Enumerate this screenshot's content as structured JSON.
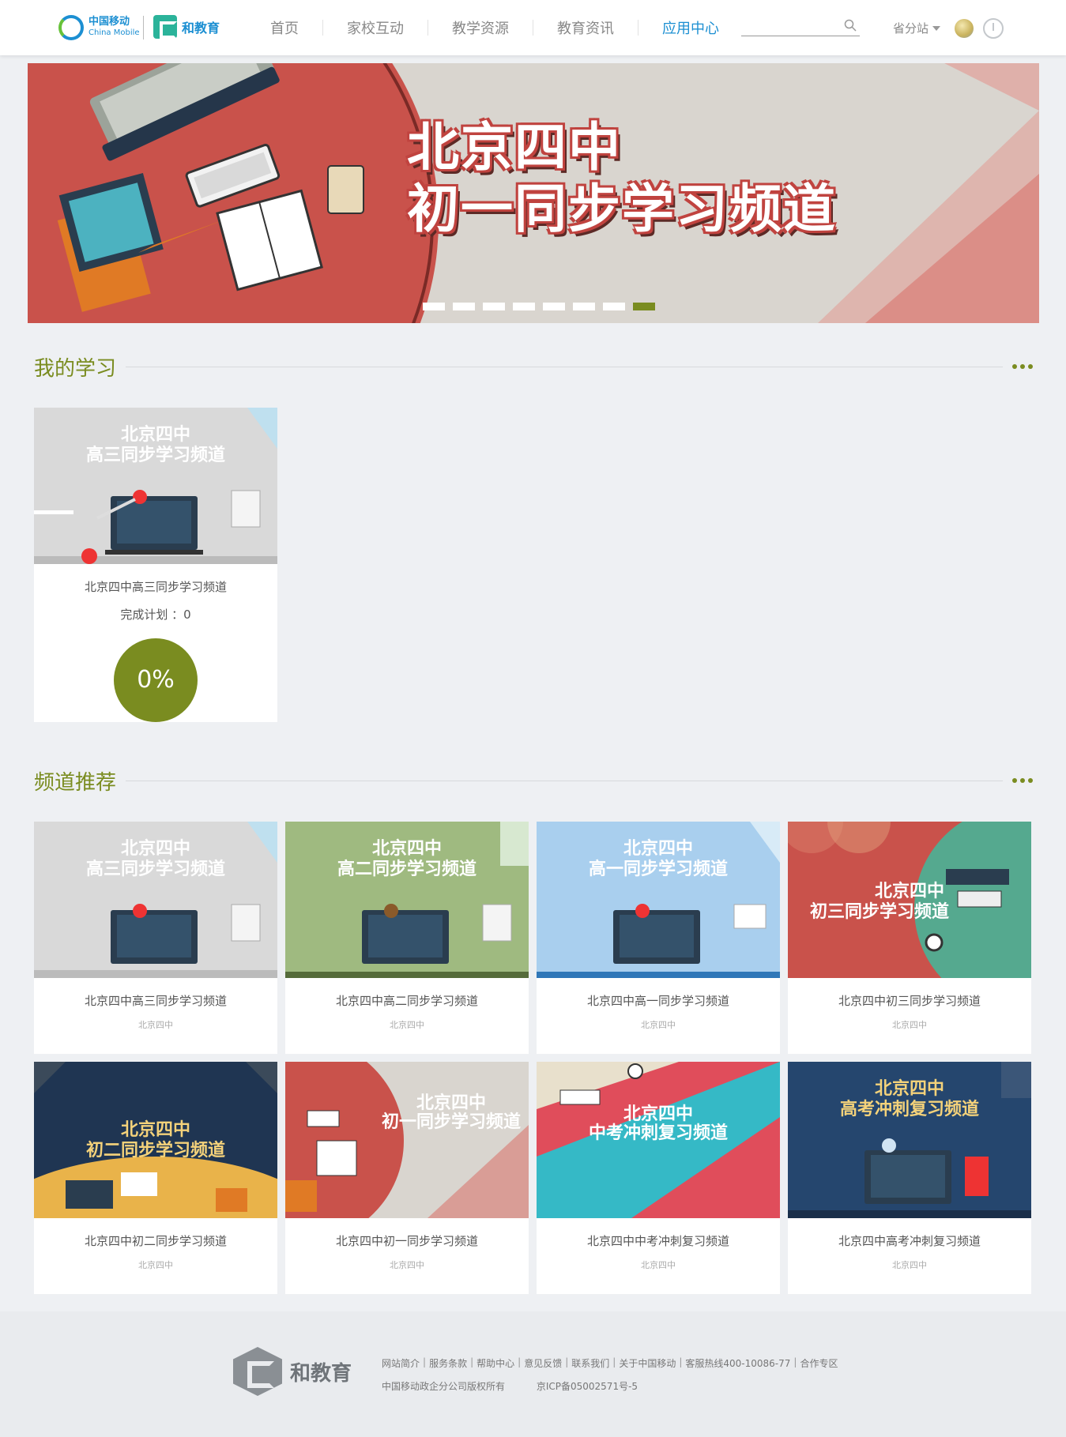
{
  "header": {
    "cm_logo_cn": "中国移动",
    "cm_logo_en": "China Mobile",
    "he_logo": "和教育",
    "nav": [
      "首页",
      "家校互动",
      "教学资源",
      "教育资讯",
      "应用中心"
    ],
    "active_nav": "应用中心",
    "search_placeholder": "",
    "province": "省分站"
  },
  "banner": {
    "title_line1": "北京四中",
    "title_line2": "初一同步学习频道",
    "slide_count": 8,
    "active_slide": 8
  },
  "my_learning": {
    "title": "我的学习",
    "cards": [
      {
        "name": "北京四中高三同步学习频道",
        "plan_label": "完成计划 ：0",
        "progress": "0%",
        "thumb_line1": "北京四中",
        "thumb_line2": "高三同步学习频道"
      }
    ]
  },
  "recommend": {
    "title": "频道推荐",
    "cards": [
      {
        "name": "北京四中高三同步学习频道",
        "school": "北京四中",
        "thumb_line1": "北京四中",
        "thumb_line2": "高三同步学习频道"
      },
      {
        "name": "北京四中高二同步学习频道",
        "school": "北京四中",
        "thumb_line1": "北京四中",
        "thumb_line2": "高二同步学习频道"
      },
      {
        "name": "北京四中高一同步学习频道",
        "school": "北京四中",
        "thumb_line1": "北京四中",
        "thumb_line2": "高一同步学习频道"
      },
      {
        "name": "北京四中初三同步学习频道",
        "school": "北京四中",
        "thumb_line1": "北京四中",
        "thumb_line2": "初三同步学习频道"
      },
      {
        "name": "北京四中初二同步学习频道",
        "school": "北京四中",
        "thumb_line1": "北京四中",
        "thumb_line2": "初二同步学习频道"
      },
      {
        "name": "北京四中初一同步学习频道",
        "school": "北京四中",
        "thumb_line1": "北京四中",
        "thumb_line2": "初一同步学习频道"
      },
      {
        "name": "北京四中中考冲刺复习频道",
        "school": "北京四中",
        "thumb_line1": "北京四中",
        "thumb_line2": "中考冲刺复习频道"
      },
      {
        "name": "北京四中高考冲刺复习频道",
        "school": "北京四中",
        "thumb_line1": "北京四中",
        "thumb_line2": "高考冲刺复习频道"
      }
    ]
  },
  "footer": {
    "logo": "和教育",
    "links": [
      "网站简介",
      "服务条款",
      "帮助中心",
      "意见反馈",
      "联系我们",
      "关于中国移动",
      "客服热线400-10086-77",
      "合作专区"
    ],
    "copyright": "中国移动政企分公司版权所有",
    "icp": "京ICP备05002571号-5"
  },
  "colors": {
    "accent": "#7a8c20",
    "brand_blue": "#1c8fd2",
    "banner_red": "#c9524b"
  }
}
